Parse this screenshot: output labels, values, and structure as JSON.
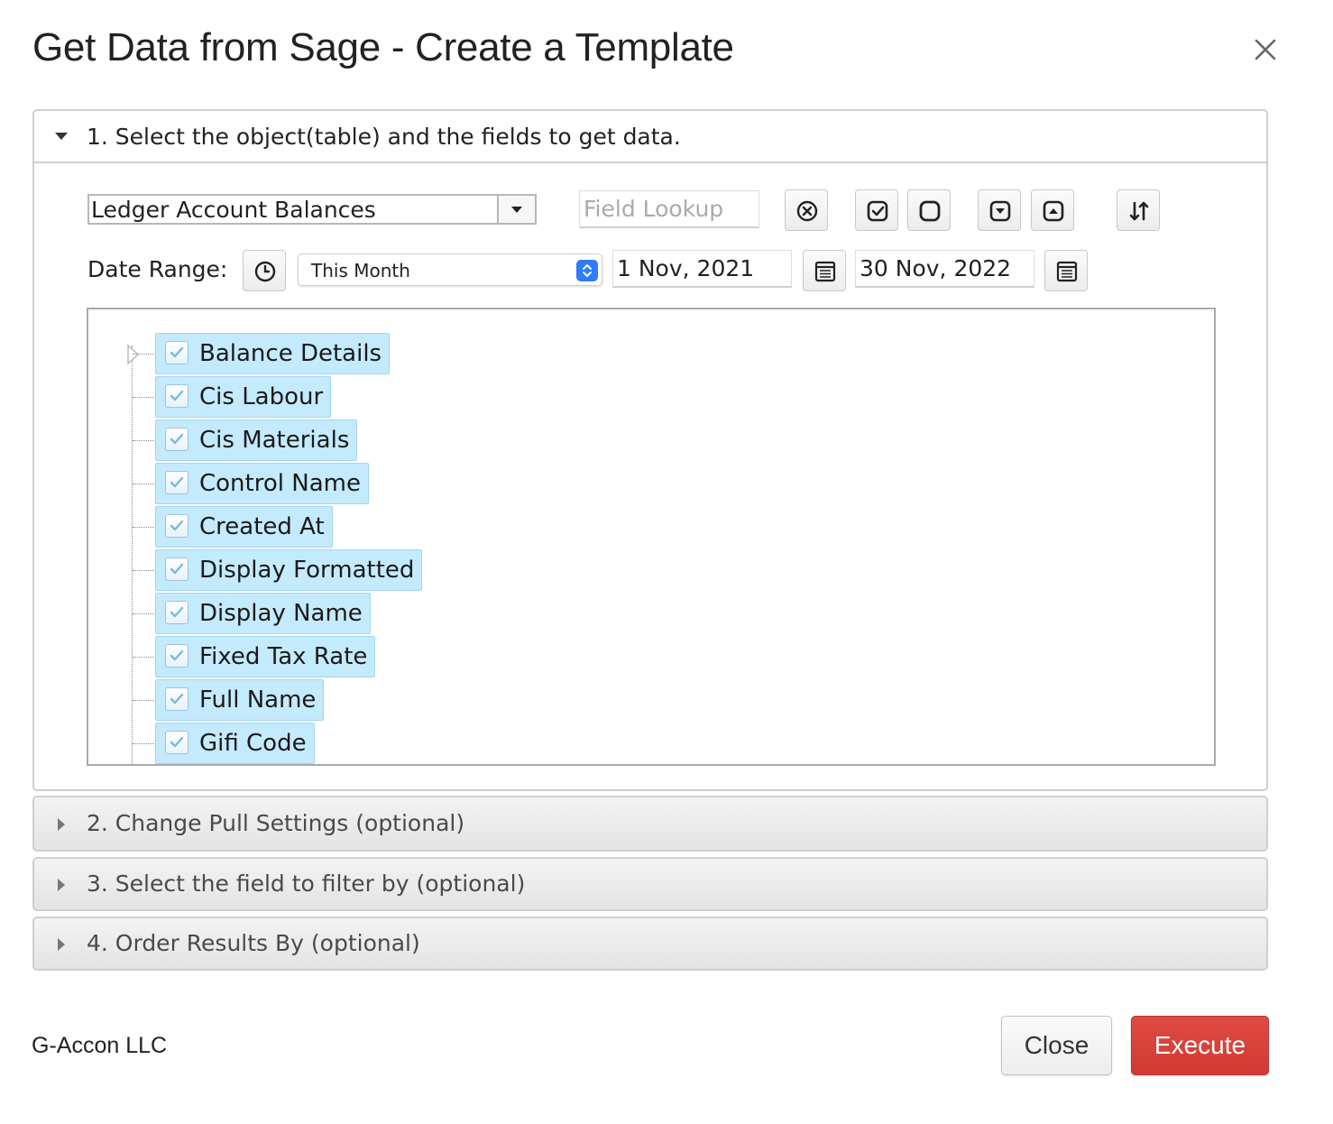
{
  "dialog": {
    "title": "Get Data from Sage - Create a Template"
  },
  "section1": {
    "heading": "1. Select the object(table) and the fields to get data.",
    "object_select": {
      "value": "Ledger Account Balances"
    },
    "field_lookup": {
      "placeholder": "Field Lookup",
      "value": ""
    },
    "date_range": {
      "label": "Date Range:",
      "preset": "This Month",
      "start_date": "1 Nov, 2021",
      "end_date": "30 Nov, 2022"
    },
    "fields": [
      {
        "label": "Balance Details",
        "checked": true
      },
      {
        "label": "Cis Labour",
        "checked": true
      },
      {
        "label": "Cis Materials",
        "checked": true
      },
      {
        "label": "Control Name",
        "checked": true
      },
      {
        "label": "Created At",
        "checked": true
      },
      {
        "label": "Display Formatted",
        "checked": true
      },
      {
        "label": "Display Name",
        "checked": true
      },
      {
        "label": "Fixed Tax Rate",
        "checked": true
      },
      {
        "label": "Full Name",
        "checked": true
      },
      {
        "label": "Gifi Code",
        "checked": true
      }
    ]
  },
  "section2": {
    "heading": "2. Change Pull Settings (optional)"
  },
  "section3": {
    "heading": "3. Select the field to filter by (optional)"
  },
  "section4": {
    "heading": "4. Order Results By (optional)"
  },
  "footer": {
    "company": "G-Accon LLC",
    "close_label": "Close",
    "execute_label": "Execute"
  },
  "icons": {
    "close": "close-x-icon",
    "clear": "circle-x-icon",
    "select_all": "check-square-icon",
    "deselect_all": "empty-square-icon",
    "expand_all": "square-chevron-down-icon",
    "collapse_all": "square-chevron-up-icon",
    "sort": "sort-arrows-icon",
    "clock": "clock-icon",
    "calendar": "calendar-list-icon"
  },
  "colors": {
    "execute": "#d8413a",
    "selected_field_bg": "#c4eafd",
    "stepper": "#2f7cf6"
  }
}
